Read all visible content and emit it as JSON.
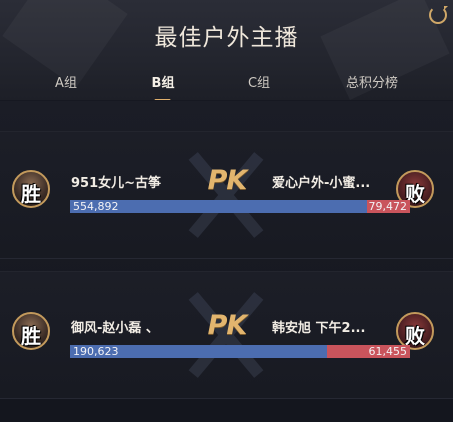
{
  "header": {
    "title": "最佳户外主播"
  },
  "tabs": [
    {
      "label": "A组",
      "active": false
    },
    {
      "label": "B组",
      "active": true
    },
    {
      "label": "C组",
      "active": false
    },
    {
      "label": "总积分榜",
      "active": false
    }
  ],
  "matches": [
    {
      "left": {
        "name": "951女儿~古筝",
        "badge": "胜",
        "score": "554,892",
        "score_value": 554892
      },
      "vs": "PK",
      "right": {
        "name": "爱心户外-小蜜...",
        "badge": "败",
        "score": "79,472",
        "score_value": 79472
      }
    },
    {
      "left": {
        "name": "御风-赵小磊 、",
        "badge": "胜",
        "score": "190,623",
        "score_value": 190623
      },
      "vs": "PK",
      "right": {
        "name": "韩安旭 下午2...",
        "badge": "败",
        "score": "61,455",
        "score_value": 61455
      }
    }
  ],
  "colors": {
    "accent": "#e0b06c",
    "left_bar": "#4c6db0",
    "right_bar": "#c9545c"
  },
  "icons": {
    "refresh": "refresh-icon"
  }
}
